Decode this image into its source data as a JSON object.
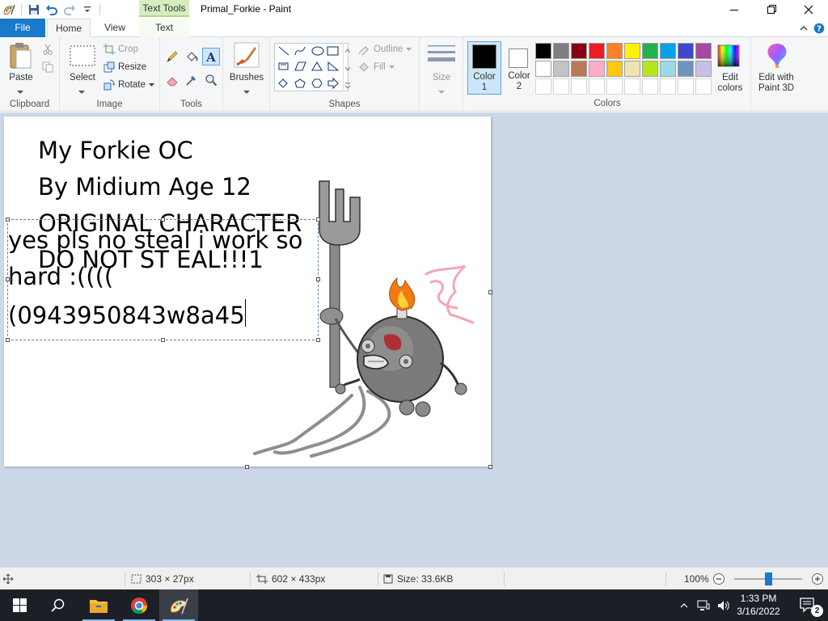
{
  "window": {
    "title": "Primal_Forkie - Paint",
    "context_tab": "Text Tools"
  },
  "tabs": {
    "file": "File",
    "home": "Home",
    "view": "View",
    "text": "Text"
  },
  "ribbon": {
    "clipboard": {
      "label": "Clipboard",
      "paste": "Paste"
    },
    "image": {
      "label": "Image",
      "select": "Select",
      "crop": "Crop",
      "resize": "Resize",
      "rotate": "Rotate"
    },
    "tools": {
      "label": "Tools"
    },
    "brushes": {
      "label": "Brushes"
    },
    "shapes": {
      "label": "Shapes",
      "outline": "Outline",
      "fill": "Fill"
    },
    "size": {
      "label": "Size"
    },
    "colors": {
      "label": "Colors",
      "color1": "Color",
      "color1_num": "1",
      "color2": "Color",
      "color2_num": "2",
      "color1_value": "#000000",
      "color2_value": "#ffffff",
      "edit_colors_line1": "Edit",
      "edit_colors_line2": "colors",
      "palette_row1": [
        "#000000",
        "#7f7f7f",
        "#880015",
        "#ed1c24",
        "#ff7f27",
        "#fff200",
        "#22b14c",
        "#00a2e8",
        "#3f48cc",
        "#a349a4"
      ],
      "palette_row2": [
        "#ffffff",
        "#c3c3c3",
        "#b97a57",
        "#ffaec9",
        "#ffc90e",
        "#efe4b0",
        "#b5e61d",
        "#99d9ea",
        "#7092be",
        "#c8bfe7"
      ]
    },
    "paint3d": {
      "line1": "Edit with",
      "line2": "Paint 3D"
    }
  },
  "canvas": {
    "lines_back": [
      "My Forkie OC",
      "By Midium Age 12",
      "ORIGINAL CHARACTER",
      "DO NOT ST EAL!!!1"
    ],
    "lines_edit": [
      "yes pls no steal i work so",
      "hard :((((",
      "(0943950843w8a45"
    ]
  },
  "status": {
    "selection_size": "303 × 27px",
    "canvas_size": "602 × 433px",
    "file_size": "Size: 33.6KB",
    "zoom": "100%",
    "zoom_level_percent": 100
  },
  "taskbar": {
    "time": "1:33 PM",
    "date": "3/16/2022",
    "notification_count": "2"
  }
}
